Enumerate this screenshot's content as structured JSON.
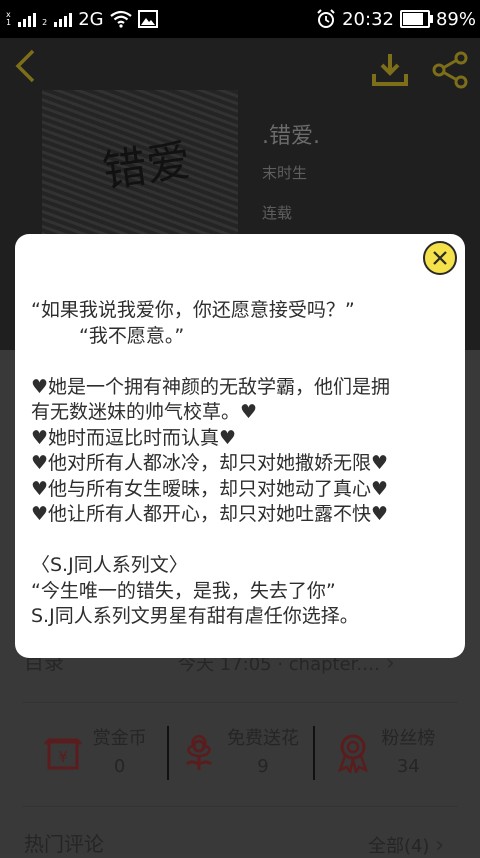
{
  "status_bar": {
    "network": "2G",
    "time": "20:32",
    "battery": "89%",
    "battery_level": 0.89
  },
  "book": {
    "title": ".错爱.",
    "author": "末时生",
    "status": "连载",
    "cover_text": "错爱"
  },
  "dialog": {
    "intro_lines": [
      "“如果我说我爱你，你还愿意接受吗？”",
      "“我不愿意。”",
      "",
      "♥她是一个拥有神颜的无敌学霸，他们是拥",
      "有无数迷妹的帅气校草。♥",
      "♥她时而逗比时而认真♥",
      "♥他对所有人都冰冷，却只对她撒娇无限♥",
      "♥他与所有女生暧昧，却只对她动了真心♥",
      "♥他让所有人都开心，却只对她吐露不快♥",
      "",
      "〈S.J同人系列文〉",
      "“今生唯一的错失，是我，失去了你”",
      "S.J同人系列文男星有甜有虐任你选择。"
    ]
  },
  "catalog": {
    "label": "目录",
    "update_info": "今天 17:05 · chapter.…"
  },
  "stats": [
    {
      "icon": "reward-coin-icon",
      "label": "赏金币",
      "value": "0"
    },
    {
      "icon": "flower-icon",
      "label": "免费送花",
      "value": "9"
    },
    {
      "icon": "fan-rank-icon",
      "label": "粉丝榜",
      "value": "34"
    }
  ],
  "comments": {
    "label": "热门评论",
    "all": "全部(4)"
  },
  "colors": {
    "accent_yellow": "#f5e14a",
    "icon_red": "#5a1c1c",
    "dim_header": "#1f1f1f"
  }
}
